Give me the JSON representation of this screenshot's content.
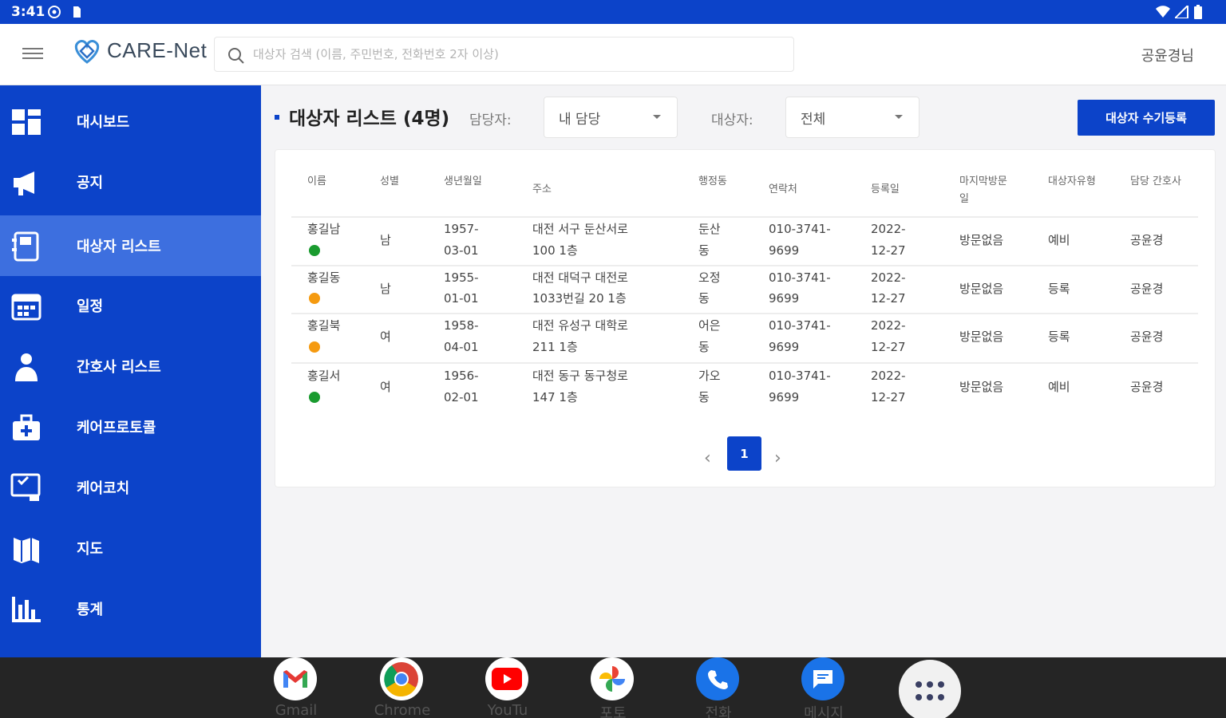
{
  "status": {
    "time": "3:41"
  },
  "header": {
    "logo": "CARE-Net",
    "search_placeholder": "대상자 검색 (이름, 주민번호, 전화번호 2자 이상)",
    "user": "공윤경님"
  },
  "sidebar": {
    "items": [
      {
        "label": "대시보드"
      },
      {
        "label": "공지"
      },
      {
        "label": "대상자 리스트"
      },
      {
        "label": "일정"
      },
      {
        "label": "간호사 리스트"
      },
      {
        "label": "케어프로토콜"
      },
      {
        "label": "케어코치"
      },
      {
        "label": "지도"
      },
      {
        "label": "통계"
      }
    ]
  },
  "main": {
    "title": "대상자 리스트 (4명)",
    "manager_label": "담당자:",
    "manager_value": "내 담당",
    "target_label": "대상자:",
    "target_value": "전체",
    "add_button": "대상자 수기등록"
  },
  "table": {
    "headers": [
      "이름",
      "성별",
      "생년월일",
      "주소",
      "행정동",
      "연락처",
      "등록일",
      "마지막방문일",
      "대상자유형",
      "담당 간호사"
    ],
    "rows": [
      {
        "name": "홍길남",
        "gender": "남",
        "birth": [
          "1957-",
          "03-01"
        ],
        "address": [
          "대전 서구 둔산서로",
          "100 1층"
        ],
        "dong": [
          "둔산",
          "동"
        ],
        "phone": [
          "010-3741-",
          "9699"
        ],
        "reg": [
          "2022-",
          "12-27"
        ],
        "visit": "방문없음",
        "type": "예비",
        "nurse": "공윤경",
        "status_color": "#1a9b2f"
      },
      {
        "name": "홍길동",
        "gender": "남",
        "birth": [
          "1955-",
          "01-01"
        ],
        "address": [
          "대전 대덕구 대전로",
          "1033번길 20 1층"
        ],
        "dong": [
          "오정",
          "동"
        ],
        "phone": [
          "010-3741-",
          "9699"
        ],
        "reg": [
          "2022-",
          "12-27"
        ],
        "visit": "방문없음",
        "type": "등록",
        "nurse": "공윤경",
        "status_color": "#f59a10"
      },
      {
        "name": "홍길북",
        "gender": "여",
        "birth": [
          "1958-",
          "04-01"
        ],
        "address": [
          "대전 유성구 대학로",
          "211 1층"
        ],
        "dong": [
          "어은",
          "동"
        ],
        "phone": [
          "010-3741-",
          "9699"
        ],
        "reg": [
          "2022-",
          "12-27"
        ],
        "visit": "방문없음",
        "type": "등록",
        "nurse": "공윤경",
        "status_color": "#f59a10"
      },
      {
        "name": "홍길서",
        "gender": "여",
        "birth": [
          "1956-",
          "02-01"
        ],
        "address": [
          "대전 동구 동구청로",
          "147 1층"
        ],
        "dong": [
          "가오",
          "동"
        ],
        "phone": [
          "010-3741-",
          "9699"
        ],
        "reg": [
          "2022-",
          "12-27"
        ],
        "visit": "방문없음",
        "type": "예비",
        "nurse": "공윤경",
        "status_color": "#1a9b2f"
      }
    ]
  },
  "pagination": {
    "current": "1"
  },
  "dock": {
    "apps": [
      {
        "name": "Gmail"
      },
      {
        "name": "Chrome"
      },
      {
        "name": "YouTu"
      },
      {
        "name": "포토"
      },
      {
        "name": "전화"
      },
      {
        "name": "메시지"
      }
    ]
  },
  "colors": {
    "primary": "#0c43c9",
    "active": "#3d6fdf",
    "green": "#1a9b2f",
    "orange": "#f59a10"
  }
}
